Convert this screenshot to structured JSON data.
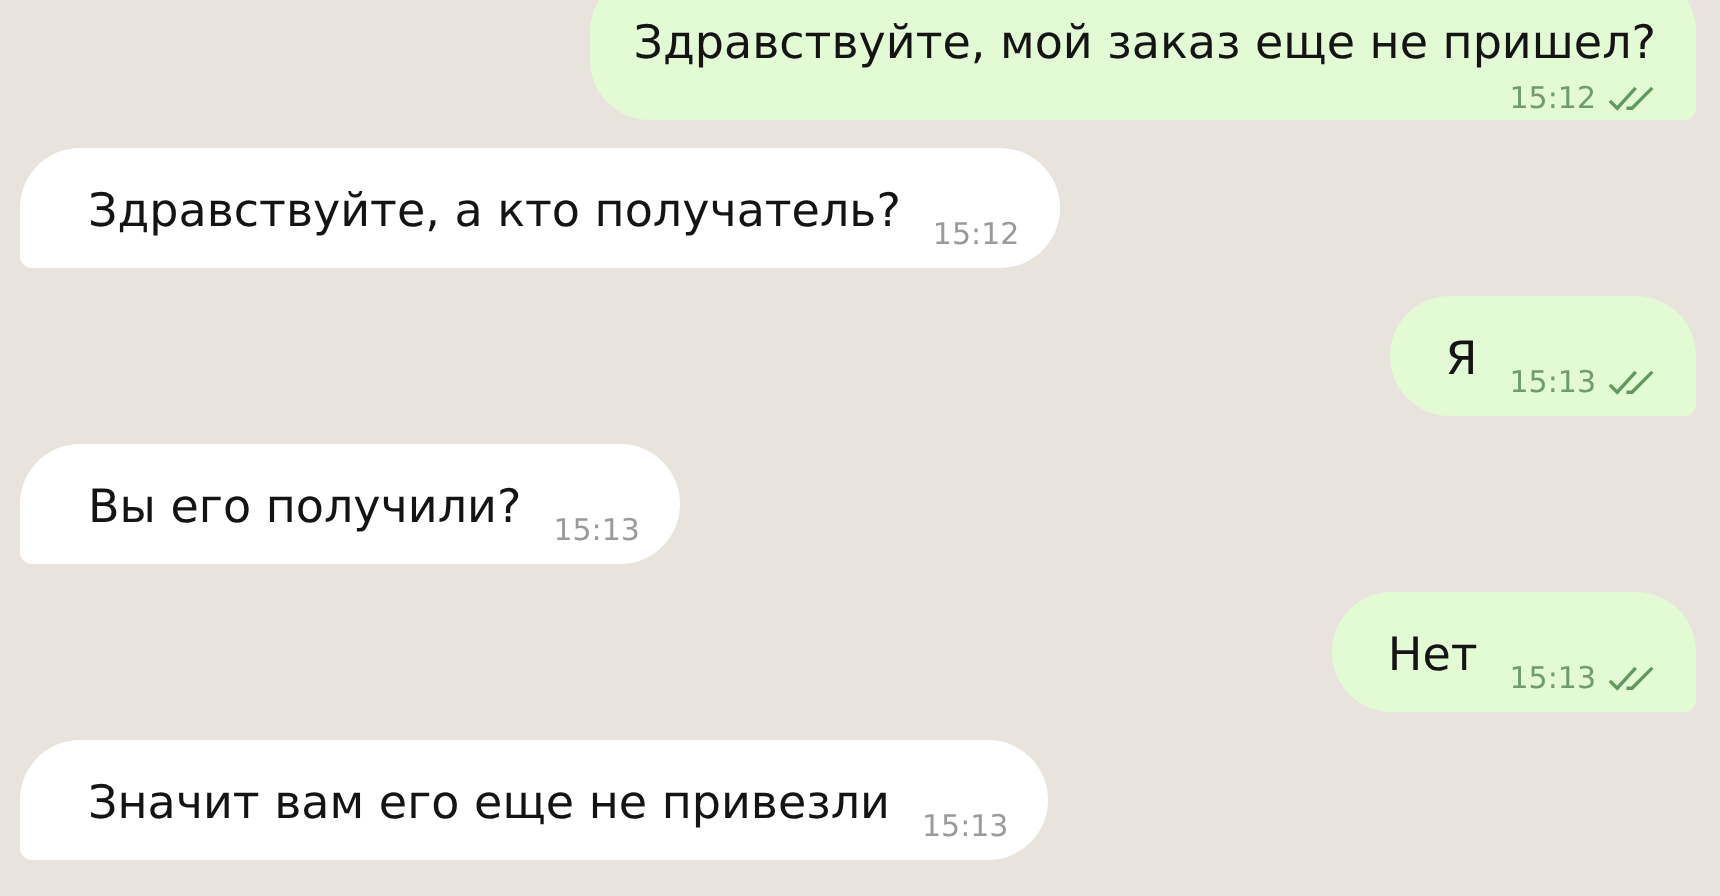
{
  "messages": [
    {
      "kind": "outgoing",
      "text": "Здравствуйте, мой заказ еще не пришел?",
      "time": "15:12",
      "delivered": true
    },
    {
      "kind": "incoming",
      "text": "Здравствуйте, а кто получатель?",
      "time": "15:12",
      "delivered": false
    },
    {
      "kind": "outgoing",
      "text": "Я",
      "time": "15:13",
      "delivered": true
    },
    {
      "kind": "incoming",
      "text": "Вы его получили?",
      "time": "15:13",
      "delivered": false
    },
    {
      "kind": "outgoing",
      "text": "Нет",
      "time": "15:13",
      "delivered": true
    },
    {
      "kind": "incoming",
      "text": "Значит вам его еще не привезли",
      "time": "15:13",
      "delivered": false
    }
  ]
}
